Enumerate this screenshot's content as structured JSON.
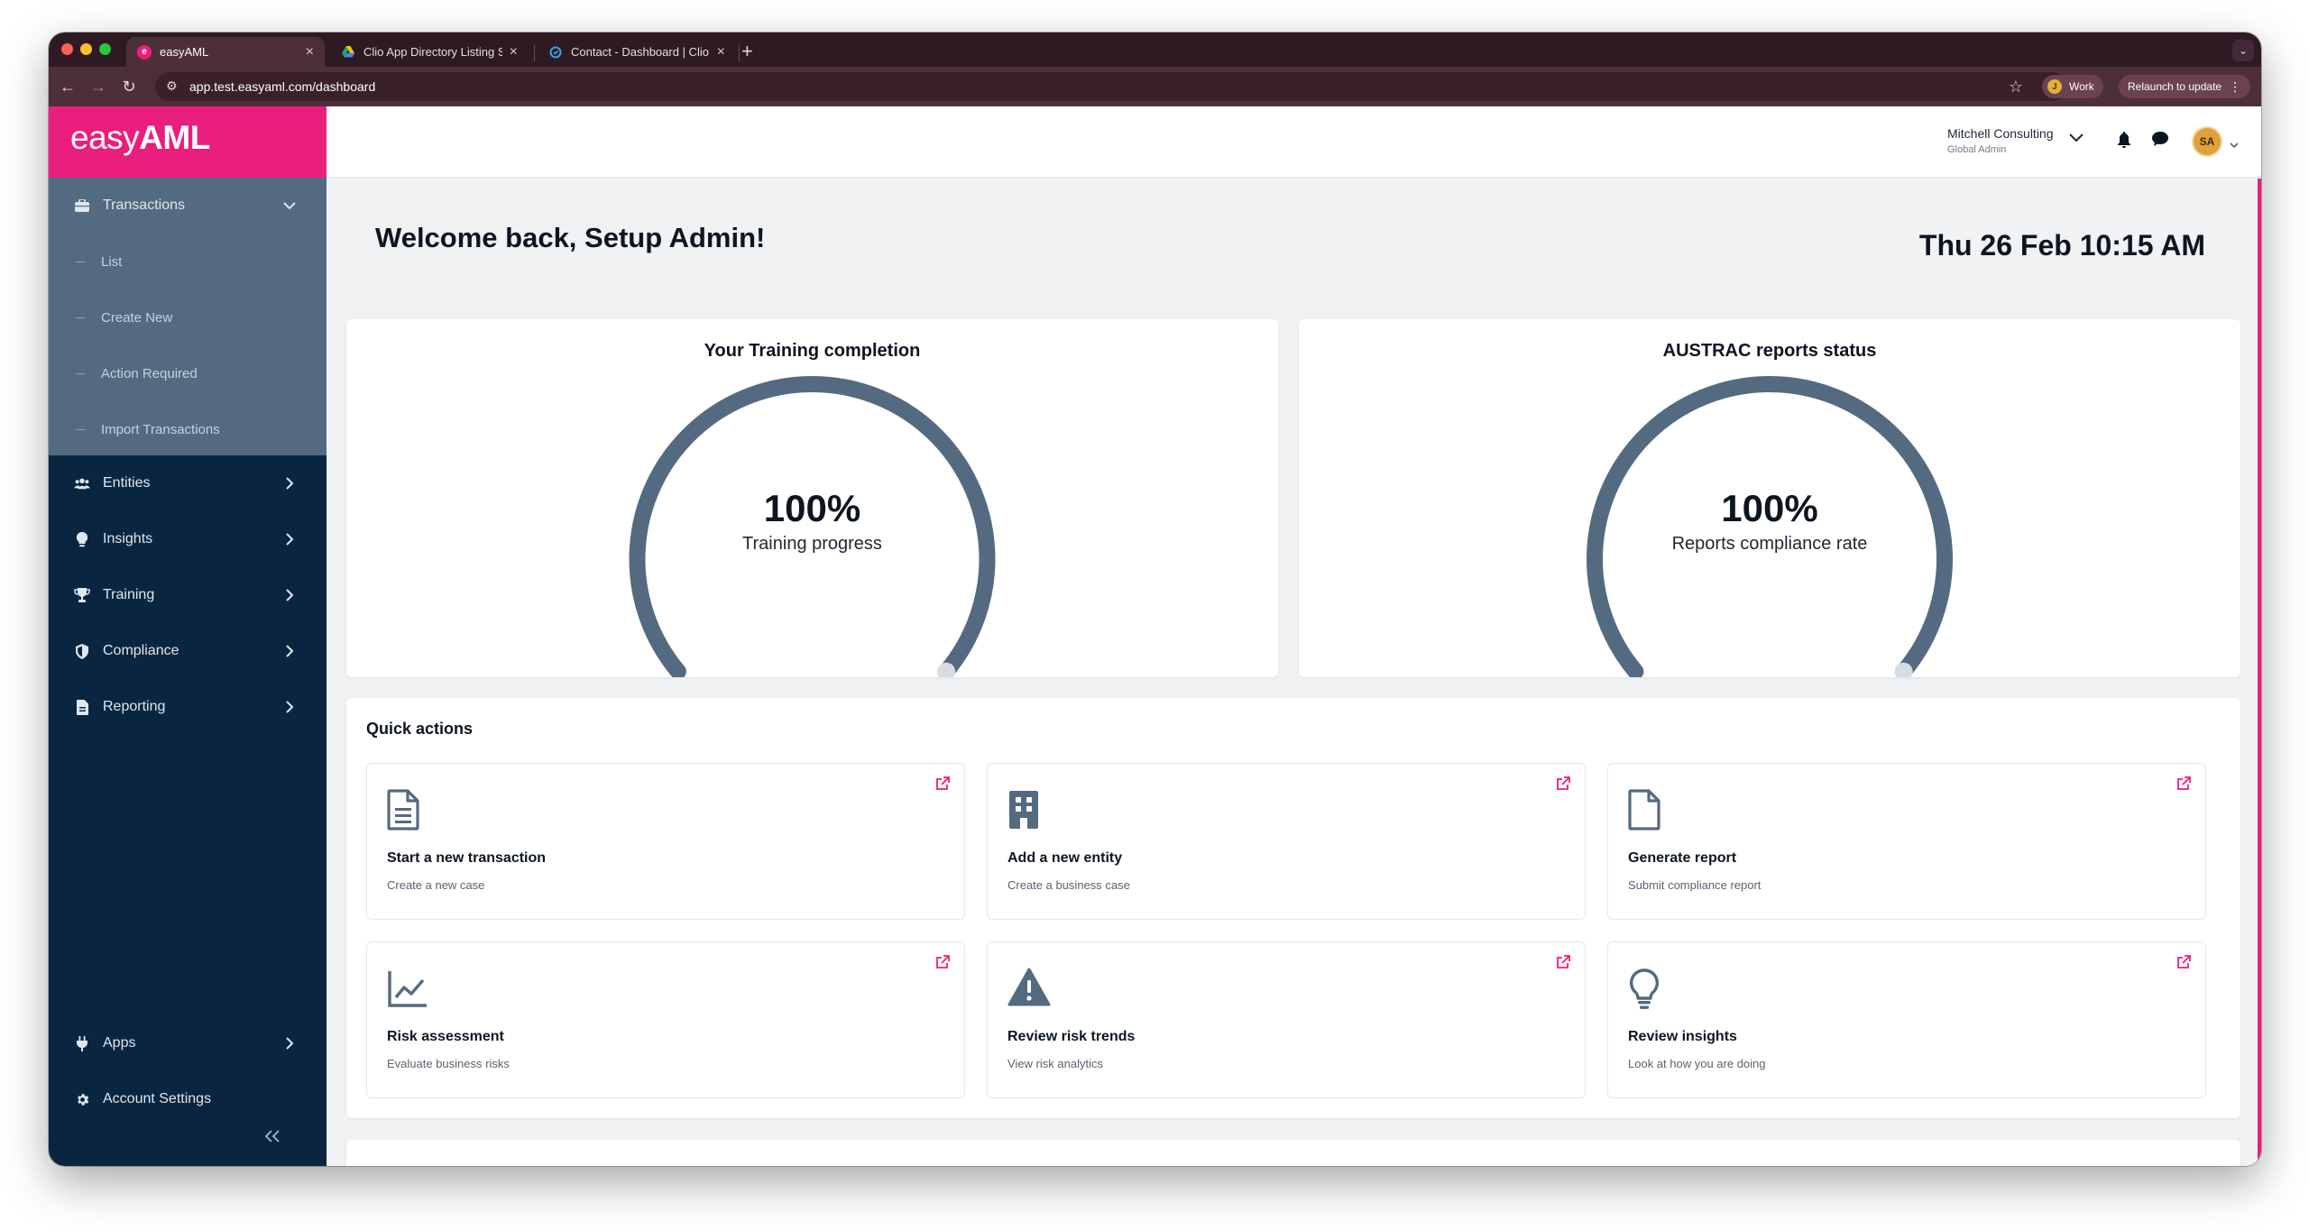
{
  "browser": {
    "tabs": [
      {
        "title": "easyAML",
        "favicon": "easyaml-favicon"
      },
      {
        "title": "Clio App Directory Listing Su",
        "favicon": "google-drive-favicon"
      },
      {
        "title": "Contact - Dashboard | Clio",
        "favicon": "clio-favicon"
      }
    ],
    "url": "app.test.easyaml.com/dashboard",
    "profile_initial": "J",
    "profile_label": "Work",
    "relaunch_label": "Relaunch to update"
  },
  "brand": {
    "name_bold": "easy",
    "name_rest": "AML",
    "color": "#ea1e7c"
  },
  "sidebar": {
    "transactions": {
      "label": "Transactions",
      "icon": "briefcase-icon"
    },
    "submenu": [
      "List",
      "Create New",
      "Action Required",
      "Import Transactions"
    ],
    "items": [
      {
        "label": "Entities",
        "icon": "users-icon"
      },
      {
        "label": "Insights",
        "icon": "lightbulb-icon"
      },
      {
        "label": "Training",
        "icon": "trophy-icon"
      },
      {
        "label": "Compliance",
        "icon": "shield-icon"
      },
      {
        "label": "Reporting",
        "icon": "document-icon"
      }
    ],
    "bottom": [
      {
        "label": "Apps",
        "icon": "plug-icon"
      },
      {
        "label": "Account Settings",
        "icon": "gear-icon"
      }
    ]
  },
  "header": {
    "org_name": "Mitchell Consulting",
    "org_role": "Global Admin",
    "avatar_initials": "SA"
  },
  "main": {
    "welcome": "Welcome back, Setup Admin!",
    "datetime": "Thu 26 Feb 10:15 AM",
    "gauges": [
      {
        "title": "Your Training completion",
        "value_text": "100%",
        "value": 1.0,
        "caption": "Training progress"
      },
      {
        "title": "AUSTRAC reports status",
        "value_text": "100%",
        "value": 1.0,
        "caption": "Reports compliance rate"
      }
    ],
    "gauge_color": "#546a80",
    "quick_actions": {
      "title": "Quick actions",
      "items": [
        {
          "label": "Start a new transaction",
          "sub": "Create a new case",
          "icon": "file-text-icon"
        },
        {
          "label": "Add a new entity",
          "sub": "Create a business case",
          "icon": "building-icon"
        },
        {
          "label": "Generate report",
          "sub": "Submit compliance report",
          "icon": "file-icon"
        },
        {
          "label": "Risk assessment",
          "sub": "Evaluate business risks",
          "icon": "line-chart-icon"
        },
        {
          "label": "Review risk trends",
          "sub": "View risk analytics",
          "icon": "warning-icon"
        },
        {
          "label": "Review insights",
          "sub": "Look at how you are doing",
          "icon": "lightbulb-icon"
        }
      ]
    }
  }
}
